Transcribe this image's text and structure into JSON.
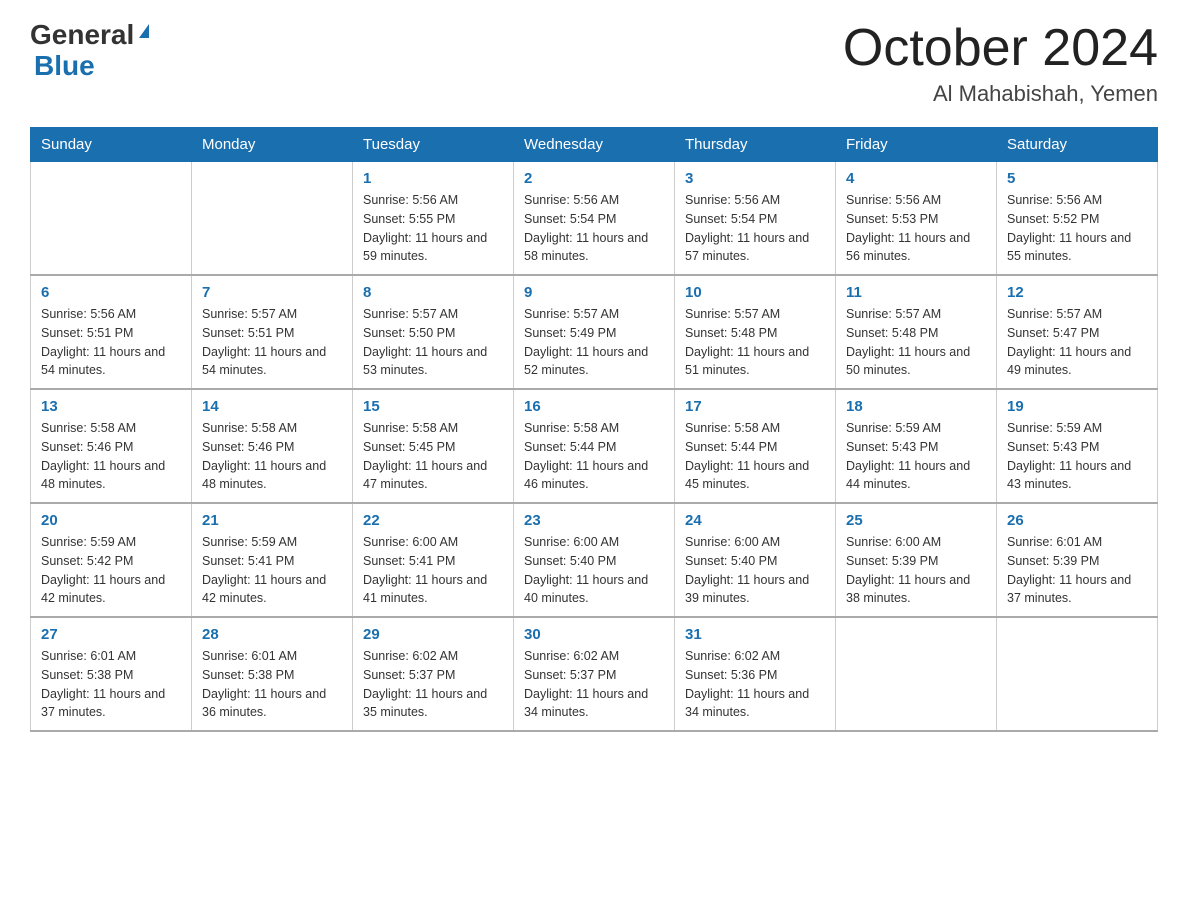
{
  "header": {
    "logo_general": "General",
    "logo_blue": "Blue",
    "title": "October 2024",
    "subtitle": "Al Mahabishah, Yemen"
  },
  "days_of_week": [
    "Sunday",
    "Monday",
    "Tuesday",
    "Wednesday",
    "Thursday",
    "Friday",
    "Saturday"
  ],
  "weeks": [
    [
      {
        "day": "",
        "sunrise": "",
        "sunset": "",
        "daylight": ""
      },
      {
        "day": "",
        "sunrise": "",
        "sunset": "",
        "daylight": ""
      },
      {
        "day": "1",
        "sunrise": "Sunrise: 5:56 AM",
        "sunset": "Sunset: 5:55 PM",
        "daylight": "Daylight: 11 hours and 59 minutes."
      },
      {
        "day": "2",
        "sunrise": "Sunrise: 5:56 AM",
        "sunset": "Sunset: 5:54 PM",
        "daylight": "Daylight: 11 hours and 58 minutes."
      },
      {
        "day": "3",
        "sunrise": "Sunrise: 5:56 AM",
        "sunset": "Sunset: 5:54 PM",
        "daylight": "Daylight: 11 hours and 57 minutes."
      },
      {
        "day": "4",
        "sunrise": "Sunrise: 5:56 AM",
        "sunset": "Sunset: 5:53 PM",
        "daylight": "Daylight: 11 hours and 56 minutes."
      },
      {
        "day": "5",
        "sunrise": "Sunrise: 5:56 AM",
        "sunset": "Sunset: 5:52 PM",
        "daylight": "Daylight: 11 hours and 55 minutes."
      }
    ],
    [
      {
        "day": "6",
        "sunrise": "Sunrise: 5:56 AM",
        "sunset": "Sunset: 5:51 PM",
        "daylight": "Daylight: 11 hours and 54 minutes."
      },
      {
        "day": "7",
        "sunrise": "Sunrise: 5:57 AM",
        "sunset": "Sunset: 5:51 PM",
        "daylight": "Daylight: 11 hours and 54 minutes."
      },
      {
        "day": "8",
        "sunrise": "Sunrise: 5:57 AM",
        "sunset": "Sunset: 5:50 PM",
        "daylight": "Daylight: 11 hours and 53 minutes."
      },
      {
        "day": "9",
        "sunrise": "Sunrise: 5:57 AM",
        "sunset": "Sunset: 5:49 PM",
        "daylight": "Daylight: 11 hours and 52 minutes."
      },
      {
        "day": "10",
        "sunrise": "Sunrise: 5:57 AM",
        "sunset": "Sunset: 5:48 PM",
        "daylight": "Daylight: 11 hours and 51 minutes."
      },
      {
        "day": "11",
        "sunrise": "Sunrise: 5:57 AM",
        "sunset": "Sunset: 5:48 PM",
        "daylight": "Daylight: 11 hours and 50 minutes."
      },
      {
        "day": "12",
        "sunrise": "Sunrise: 5:57 AM",
        "sunset": "Sunset: 5:47 PM",
        "daylight": "Daylight: 11 hours and 49 minutes."
      }
    ],
    [
      {
        "day": "13",
        "sunrise": "Sunrise: 5:58 AM",
        "sunset": "Sunset: 5:46 PM",
        "daylight": "Daylight: 11 hours and 48 minutes."
      },
      {
        "day": "14",
        "sunrise": "Sunrise: 5:58 AM",
        "sunset": "Sunset: 5:46 PM",
        "daylight": "Daylight: 11 hours and 48 minutes."
      },
      {
        "day": "15",
        "sunrise": "Sunrise: 5:58 AM",
        "sunset": "Sunset: 5:45 PM",
        "daylight": "Daylight: 11 hours and 47 minutes."
      },
      {
        "day": "16",
        "sunrise": "Sunrise: 5:58 AM",
        "sunset": "Sunset: 5:44 PM",
        "daylight": "Daylight: 11 hours and 46 minutes."
      },
      {
        "day": "17",
        "sunrise": "Sunrise: 5:58 AM",
        "sunset": "Sunset: 5:44 PM",
        "daylight": "Daylight: 11 hours and 45 minutes."
      },
      {
        "day": "18",
        "sunrise": "Sunrise: 5:59 AM",
        "sunset": "Sunset: 5:43 PM",
        "daylight": "Daylight: 11 hours and 44 minutes."
      },
      {
        "day": "19",
        "sunrise": "Sunrise: 5:59 AM",
        "sunset": "Sunset: 5:43 PM",
        "daylight": "Daylight: 11 hours and 43 minutes."
      }
    ],
    [
      {
        "day": "20",
        "sunrise": "Sunrise: 5:59 AM",
        "sunset": "Sunset: 5:42 PM",
        "daylight": "Daylight: 11 hours and 42 minutes."
      },
      {
        "day": "21",
        "sunrise": "Sunrise: 5:59 AM",
        "sunset": "Sunset: 5:41 PM",
        "daylight": "Daylight: 11 hours and 42 minutes."
      },
      {
        "day": "22",
        "sunrise": "Sunrise: 6:00 AM",
        "sunset": "Sunset: 5:41 PM",
        "daylight": "Daylight: 11 hours and 41 minutes."
      },
      {
        "day": "23",
        "sunrise": "Sunrise: 6:00 AM",
        "sunset": "Sunset: 5:40 PM",
        "daylight": "Daylight: 11 hours and 40 minutes."
      },
      {
        "day": "24",
        "sunrise": "Sunrise: 6:00 AM",
        "sunset": "Sunset: 5:40 PM",
        "daylight": "Daylight: 11 hours and 39 minutes."
      },
      {
        "day": "25",
        "sunrise": "Sunrise: 6:00 AM",
        "sunset": "Sunset: 5:39 PM",
        "daylight": "Daylight: 11 hours and 38 minutes."
      },
      {
        "day": "26",
        "sunrise": "Sunrise: 6:01 AM",
        "sunset": "Sunset: 5:39 PM",
        "daylight": "Daylight: 11 hours and 37 minutes."
      }
    ],
    [
      {
        "day": "27",
        "sunrise": "Sunrise: 6:01 AM",
        "sunset": "Sunset: 5:38 PM",
        "daylight": "Daylight: 11 hours and 37 minutes."
      },
      {
        "day": "28",
        "sunrise": "Sunrise: 6:01 AM",
        "sunset": "Sunset: 5:38 PM",
        "daylight": "Daylight: 11 hours and 36 minutes."
      },
      {
        "day": "29",
        "sunrise": "Sunrise: 6:02 AM",
        "sunset": "Sunset: 5:37 PM",
        "daylight": "Daylight: 11 hours and 35 minutes."
      },
      {
        "day": "30",
        "sunrise": "Sunrise: 6:02 AM",
        "sunset": "Sunset: 5:37 PM",
        "daylight": "Daylight: 11 hours and 34 minutes."
      },
      {
        "day": "31",
        "sunrise": "Sunrise: 6:02 AM",
        "sunset": "Sunset: 5:36 PM",
        "daylight": "Daylight: 11 hours and 34 minutes."
      },
      {
        "day": "",
        "sunrise": "",
        "sunset": "",
        "daylight": ""
      },
      {
        "day": "",
        "sunrise": "",
        "sunset": "",
        "daylight": ""
      }
    ]
  ]
}
